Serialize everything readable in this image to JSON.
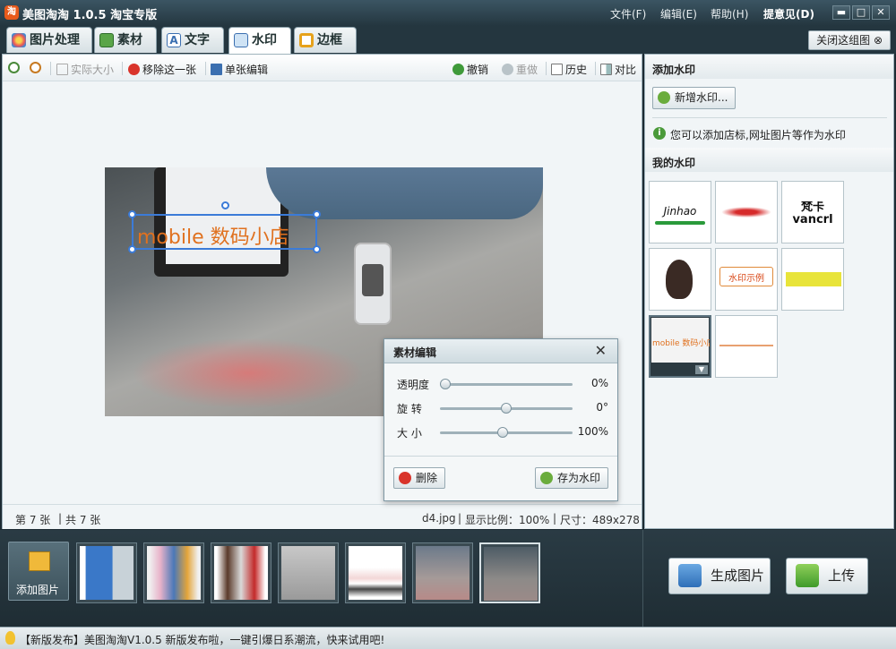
{
  "app": {
    "title": "美图淘淘 1.0.5 淘宝专版",
    "icon_label": "淘"
  },
  "menu": {
    "file": "文件(F)",
    "edit": "编辑(E)",
    "help": "帮助(H)",
    "feedback": "提意见(D)"
  },
  "tabs": [
    {
      "label": "图片处理",
      "icon": "palette-icon"
    },
    {
      "label": "素材",
      "icon": "material-icon"
    },
    {
      "label": "文字",
      "icon": "text-icon"
    },
    {
      "label": "水印",
      "icon": "watermark-icon",
      "active": true
    },
    {
      "label": "边框",
      "icon": "frame-icon"
    }
  ],
  "close_set": "关闭这组图",
  "toolbar": {
    "actual_size": "实际大小",
    "remove_this": "移除这一张",
    "single_edit": "单张编辑",
    "undo": "撤销",
    "redo": "重做",
    "history": "历史",
    "compare": "对比"
  },
  "canvas": {
    "watermark_text": "mobile 数码小店"
  },
  "status": {
    "index": "第 7 张",
    "total": "共 7 张",
    "filename": "d4.jpg",
    "ratio": "显示比例：100%",
    "size": "尺寸：489x278"
  },
  "dialog": {
    "title": "素材编辑",
    "opacity_label": "透明度",
    "opacity_value": "0%",
    "opacity": 0,
    "rotate_label": "旋 转",
    "rotate_value": "0°",
    "rotate": 0.5,
    "size_label": "大 小",
    "size_value": "100%",
    "size": 0.47,
    "delete_label": "删除",
    "save_label": "存为水印"
  },
  "right": {
    "add_header": "添加水印",
    "add_button": "新增水印...",
    "tip": "您可以添加店标,网址图片等作为水印",
    "my_header": "我的水印",
    "thumbs": [
      "Jinhao",
      "",
      "梵卡 vancrl",
      "",
      "水印示例",
      "",
      "mobile 数码小店",
      ""
    ]
  },
  "bottom": {
    "add_pic": "添加图片",
    "make_pic": "生成图片",
    "upload": "上传"
  },
  "news": "【新版发布】美图淘淘V1.0.5 新版发布啦，一键引爆日系潮流，快来试用吧!",
  "colors": {
    "accent": "#3b7bd8",
    "watermark": "#e0711f",
    "titlebar": "#2e4550"
  }
}
